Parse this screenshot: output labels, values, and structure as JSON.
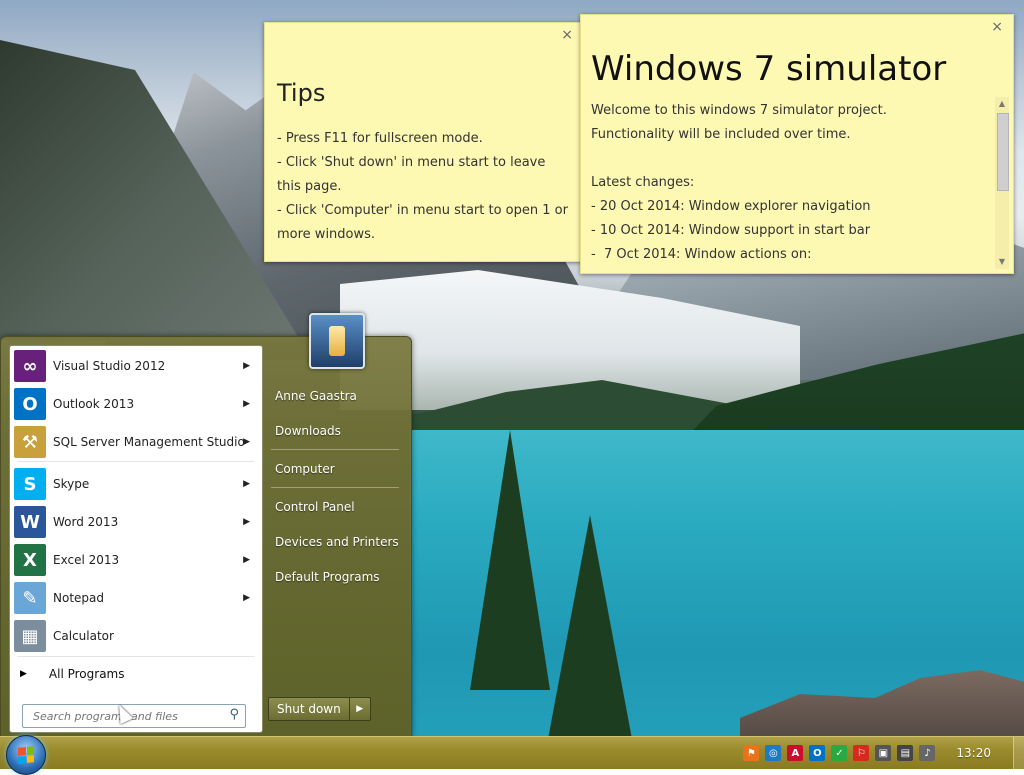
{
  "tips_note": {
    "title": "Tips",
    "close": "×",
    "lines": [
      "- Press F11 for fullscreen mode.",
      "- Click 'Shut down' in menu start to leave this page.",
      "- Click 'Computer' in menu start to open 1 or more windows."
    ]
  },
  "simulator_note": {
    "title": "Windows 7 simulator",
    "close": "×",
    "lines": [
      "Welcome to this windows 7 simulator project.",
      "Functionality will be included over time.",
      "",
      "Latest changes:",
      "- 20 Oct 2014: Window explorer navigation",
      "- 10 Oct 2014: Window support in start bar",
      "-  7 Oct 2014: Window actions on:"
    ]
  },
  "start_menu": {
    "programs": [
      {
        "label": "Visual Studio 2012",
        "icon": "visual-studio-icon",
        "color": "#68217a",
        "glyph": "∞",
        "arrow": "▶"
      },
      {
        "label": "Outlook 2013",
        "icon": "outlook-icon",
        "color": "#0072c6",
        "glyph": "O",
        "arrow": "▶"
      },
      {
        "label": "SQL Server Management Studio",
        "icon": "sql-server-icon",
        "color": "#c8a03c",
        "glyph": "⚒",
        "arrow": "▶"
      },
      {
        "label": "Skype",
        "icon": "skype-icon",
        "color": "#00aff0",
        "glyph": "S",
        "arrow": "▶"
      },
      {
        "label": "Word 2013",
        "icon": "word-icon",
        "color": "#2b579a",
        "glyph": "W",
        "arrow": "▶"
      },
      {
        "label": "Excel 2013",
        "icon": "excel-icon",
        "color": "#217346",
        "glyph": "X",
        "arrow": "▶"
      },
      {
        "label": "Notepad",
        "icon": "notepad-icon",
        "color": "#6aa6d6",
        "glyph": "✎",
        "arrow": "▶"
      },
      {
        "label": "Calculator",
        "icon": "calculator-icon",
        "color": "#7c8e9e",
        "glyph": "▦",
        "arrow": ""
      }
    ],
    "all_programs": "All Programs",
    "search_placeholder": "Search programs and files",
    "right_items": [
      "Anne Gaastra",
      "Downloads",
      "Computer",
      "Control Panel",
      "Devices and Printers",
      "Default Programs"
    ],
    "shutdown_label": "Shut down",
    "shutdown_arrow": "▶"
  },
  "taskbar": {
    "clock": "13:20",
    "tray_icons": [
      {
        "name": "tray-app-orange-icon",
        "color": "#e8731a",
        "glyph": "⚑"
      },
      {
        "name": "tray-network-globe-icon",
        "color": "#1f7ac2",
        "glyph": "◎"
      },
      {
        "name": "tray-acrobat-icon",
        "color": "#c8102e",
        "glyph": "A"
      },
      {
        "name": "tray-outlook-icon",
        "color": "#0072c6",
        "glyph": "O"
      },
      {
        "name": "tray-check-icon",
        "color": "#2aa842",
        "glyph": "✓"
      },
      {
        "name": "tray-flag-icon",
        "color": "#d52b1e",
        "glyph": "⚐"
      },
      {
        "name": "tray-device-icon",
        "color": "#555555",
        "glyph": "▣"
      },
      {
        "name": "tray-network-icon",
        "color": "#444444",
        "glyph": "▤"
      },
      {
        "name": "tray-volume-icon",
        "color": "#666666",
        "glyph": "♪"
      }
    ]
  }
}
